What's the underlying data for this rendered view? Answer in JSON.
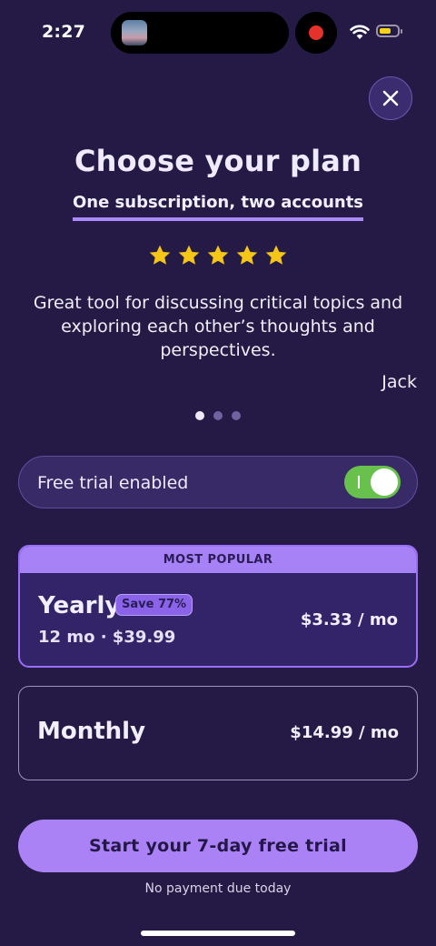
{
  "status_bar": {
    "time": "2:27",
    "icons": [
      "app-thumbnail-icon",
      "screen-recording-icon",
      "wifi-icon",
      "battery-icon"
    ]
  },
  "header": {
    "close_icon": "close-icon",
    "title": "Choose your plan",
    "subtitle": "One subscription, two accounts"
  },
  "testimonial": {
    "rating": 5,
    "star_color": "#f5c518",
    "text": "Great tool for discussing critical topics and exploring each other’s thoughts and perspectives.",
    "author": "Jack",
    "page_count": 3,
    "active_page": 1
  },
  "trial_toggle": {
    "label": "Free trial enabled",
    "enabled": true
  },
  "plans": [
    {
      "banner": "MOST POPULAR",
      "name": "Yearly",
      "badge": "Save 77%",
      "detail": "12 mo · $39.99",
      "price": "$3.33 / mo",
      "selected": true
    },
    {
      "name": "Monthly",
      "price": "$14.99 / mo",
      "selected": false
    }
  ],
  "cta": {
    "label": "Start your 7-day free trial",
    "note": "No payment due today"
  },
  "colors": {
    "background": "#241a45",
    "accent": "#ab82f6",
    "toggle_on": "#68c04d"
  }
}
